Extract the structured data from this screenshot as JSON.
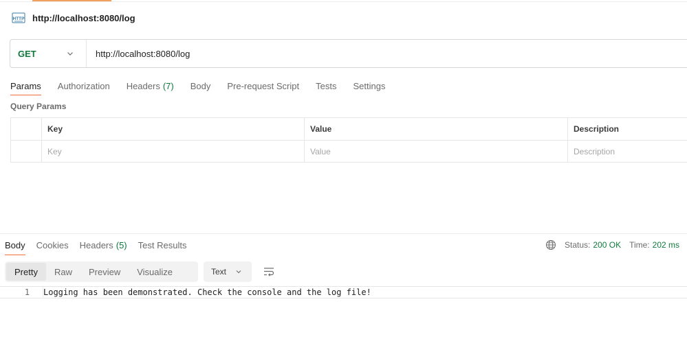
{
  "request": {
    "title": "http://localhost:8080/log",
    "method": "GET",
    "url": "http://localhost:8080/log"
  },
  "request_tabs": [
    {
      "label": "Params",
      "count": ""
    },
    {
      "label": "Authorization",
      "count": ""
    },
    {
      "label": "Headers",
      "count": "(7)"
    },
    {
      "label": "Body",
      "count": ""
    },
    {
      "label": "Pre-request Script",
      "count": ""
    },
    {
      "label": "Tests",
      "count": ""
    },
    {
      "label": "Settings",
      "count": ""
    }
  ],
  "query_params": {
    "label": "Query Params",
    "headers": {
      "key": "Key",
      "value": "Value",
      "description": "Description"
    },
    "placeholders": {
      "key": "Key",
      "value": "Value",
      "description": "Description"
    }
  },
  "response_tabs": [
    {
      "label": "Body",
      "count": ""
    },
    {
      "label": "Cookies",
      "count": ""
    },
    {
      "label": "Headers",
      "count": "(5)"
    },
    {
      "label": "Test Results",
      "count": ""
    }
  ],
  "response_meta": {
    "status_label": "Status:",
    "status_value": "200 OK",
    "time_label": "Time:",
    "time_value": "202 ms"
  },
  "view_modes": [
    "Pretty",
    "Raw",
    "Preview",
    "Visualize"
  ],
  "format": "Text",
  "body_lines": [
    {
      "num": "1",
      "text": "Logging has been demonstrated. Check the console and the log file!"
    }
  ],
  "colors": {
    "accent_orange": "#f26b3a",
    "method_green": "#0f7a3c",
    "status_green": "#0f7a3c"
  },
  "icons": {
    "request_type": "http-icon",
    "method_dropdown": "chevron-down-icon",
    "network": "globe-icon",
    "format_dropdown": "chevron-down-icon",
    "wrap": "wrap-lines-icon"
  }
}
